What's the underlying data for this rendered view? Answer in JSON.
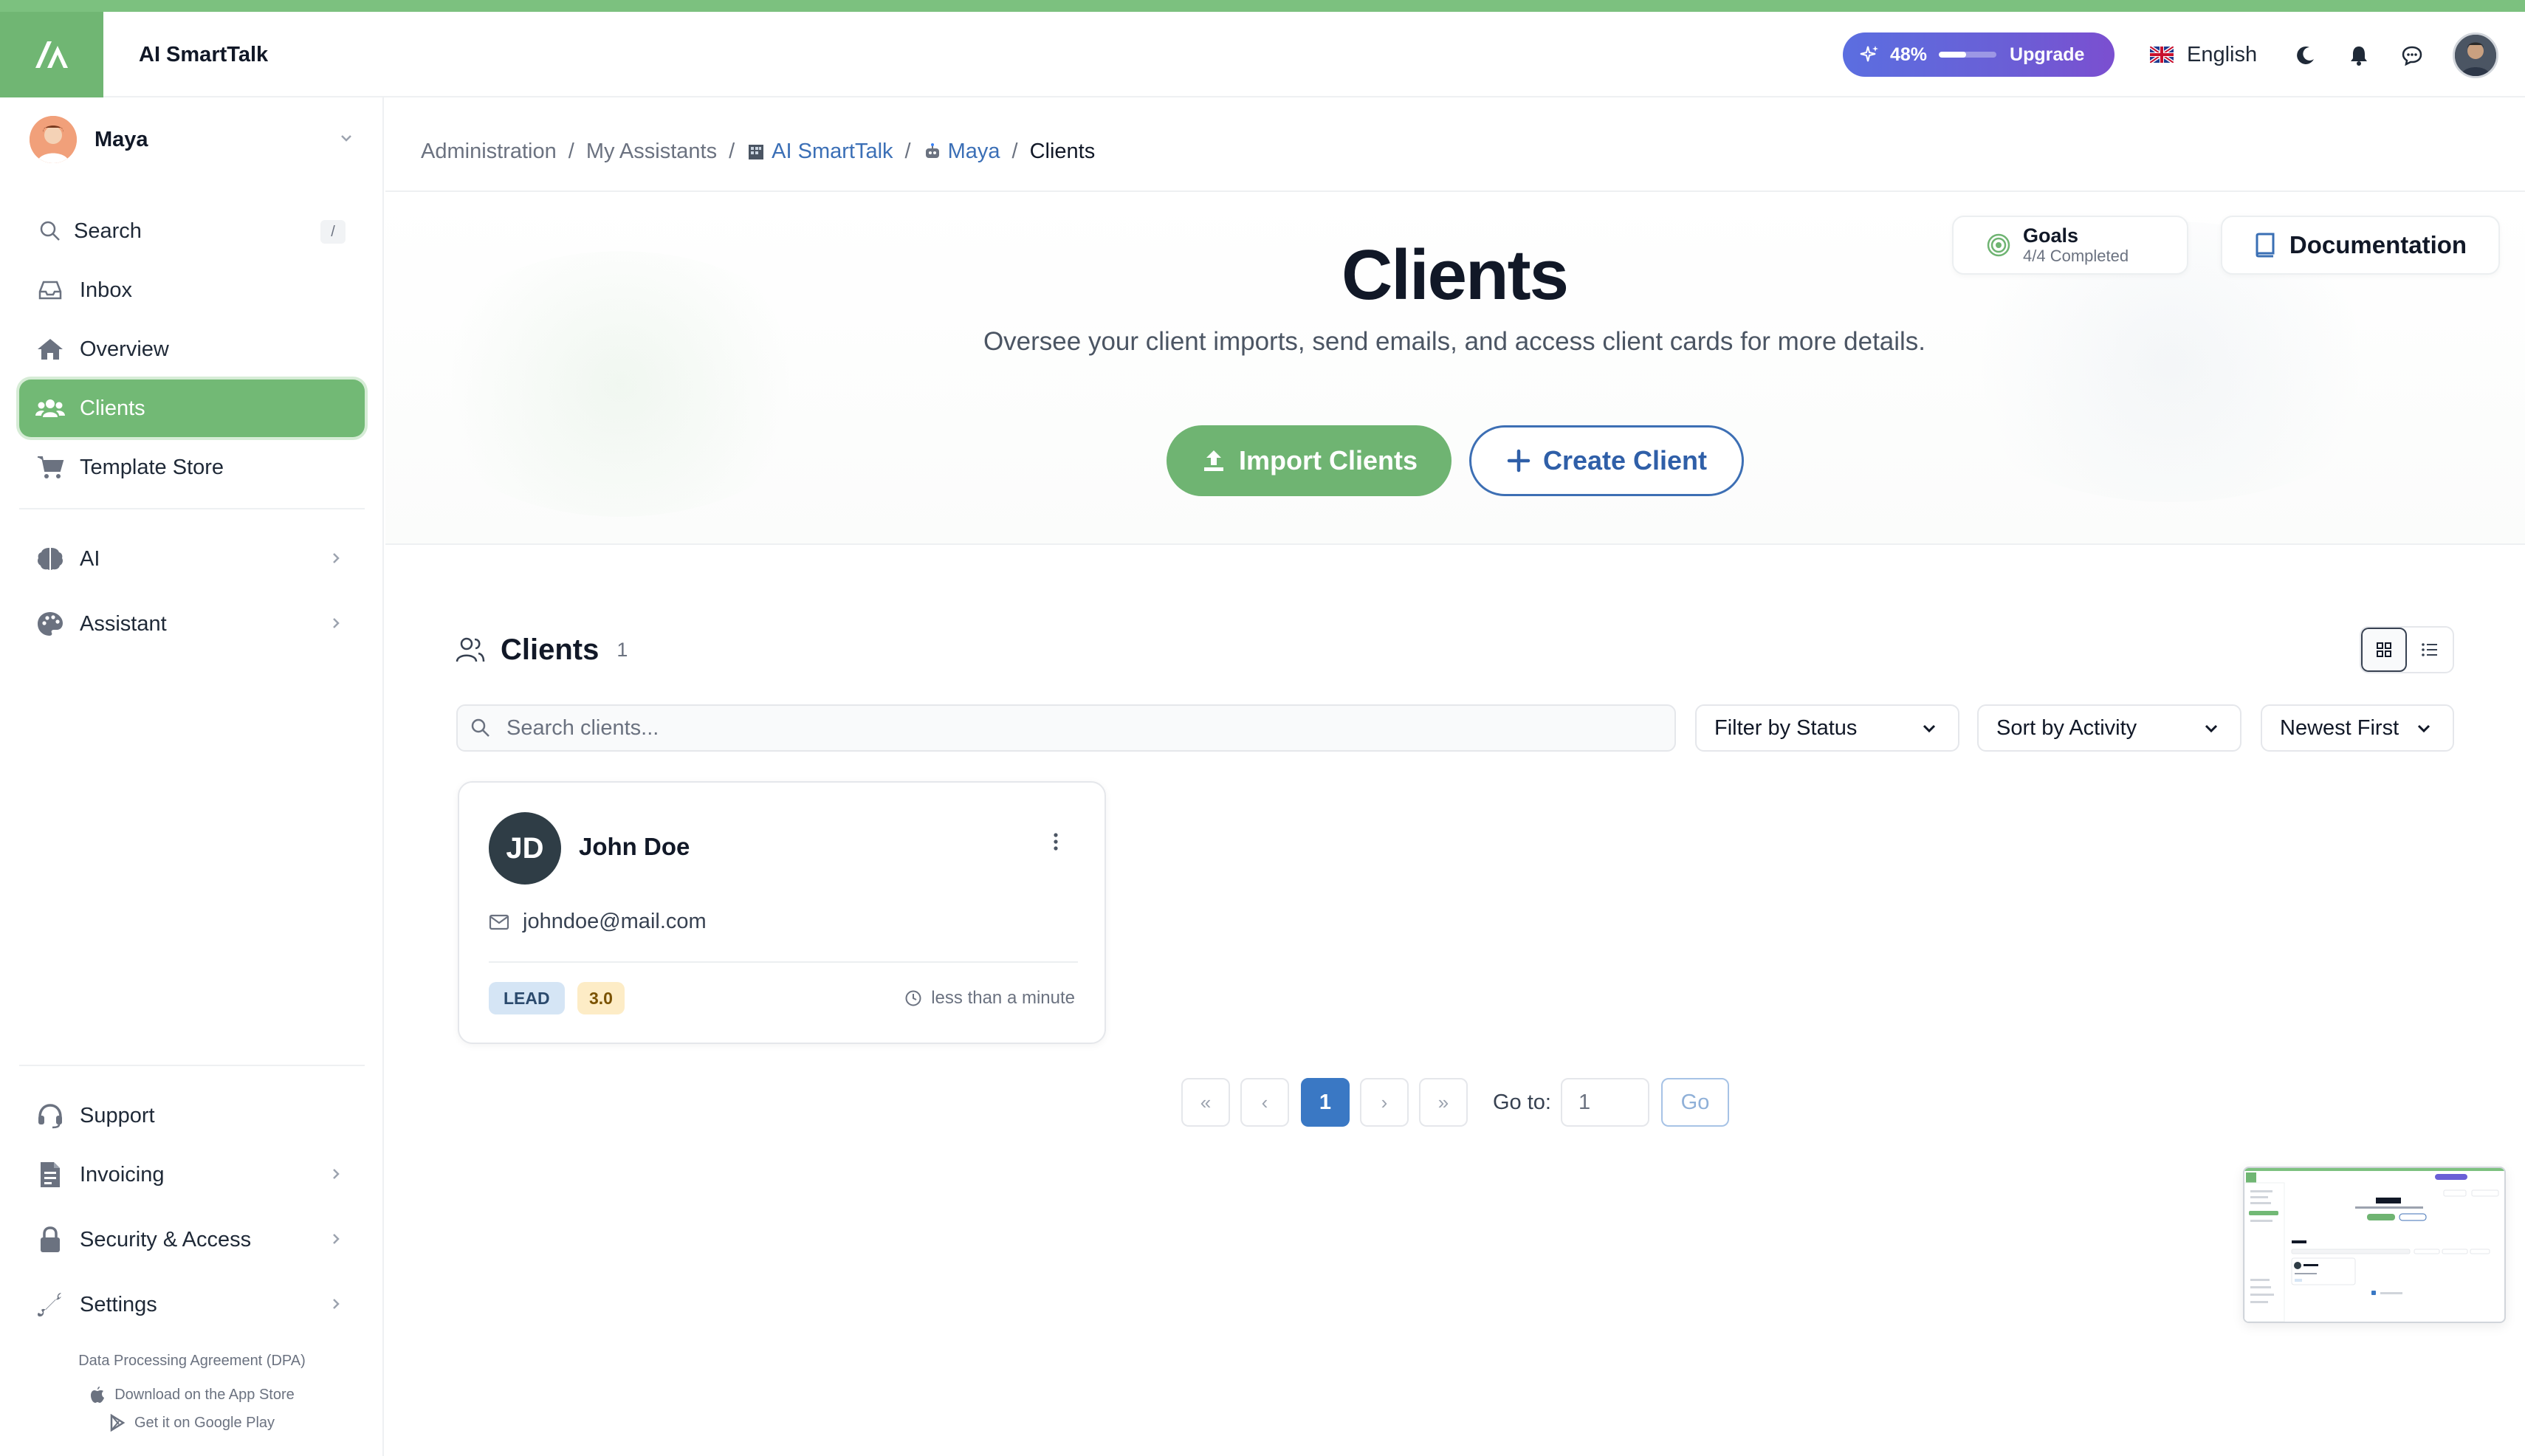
{
  "header": {
    "app_title": "AI SmartTalk",
    "usage_percent": "48%",
    "usage_fraction": 0.48,
    "upgrade_label": "Upgrade",
    "language": "English",
    "icons": [
      "logo-icon",
      "sparkle-icon",
      "uk-flag-icon",
      "moon-icon",
      "bell-icon",
      "chat-icon",
      "user-avatar"
    ]
  },
  "sidebar": {
    "user_name": "Maya",
    "items": [
      {
        "label": "Search",
        "icon": "search-icon",
        "shortcut": "/"
      },
      {
        "label": "Inbox",
        "icon": "inbox-icon"
      },
      {
        "label": "Overview",
        "icon": "home-icon"
      },
      {
        "label": "Clients",
        "icon": "users-icon",
        "active": true
      },
      {
        "label": "Template Store",
        "icon": "cart-icon"
      },
      {
        "label": "AI",
        "icon": "brain-icon"
      },
      {
        "label": "Assistant",
        "icon": "palette-icon"
      },
      {
        "label": "Support",
        "icon": "headset-icon"
      },
      {
        "label": "Invoicing",
        "icon": "invoice-icon"
      },
      {
        "label": "Security & Access",
        "icon": "lock-icon"
      },
      {
        "label": "Settings",
        "icon": "wrench-icon"
      }
    ],
    "footer": {
      "dpa": "Data Processing Agreement (DPA)",
      "app_store": "Download on the App Store",
      "google_play": "Get it on Google Play"
    }
  },
  "breadcrumb": {
    "items": [
      "Administration",
      "My Assistants",
      "AI SmartTalk",
      "Maya",
      "Clients"
    ],
    "separator": "/"
  },
  "hero": {
    "title": "Clients",
    "subtitle": "Oversee your client imports, send emails, and access client cards for more details.",
    "import_label": "Import Clients",
    "create_label": "Create Client",
    "goals_title": "Goals",
    "goals_sub": "4/4 Completed",
    "documentation_label": "Documentation"
  },
  "clients_section": {
    "title": "Clients",
    "count": "1",
    "search_placeholder": "Search clients...",
    "filter_status": "Filter by Status",
    "sort_by": "Sort by Activity",
    "order": "Newest First"
  },
  "client_card": {
    "initials": "JD",
    "name": "John Doe",
    "email": "johndoe@mail.com",
    "status": "LEAD",
    "score": "3.0",
    "last_activity": "less than a minute"
  },
  "pagination": {
    "first": "«",
    "prev": "‹",
    "current_page": "1",
    "next": "›",
    "last": "»",
    "goto_label": "Go to:",
    "goto_placeholder": "1",
    "go_label": "Go"
  },
  "colors": {
    "accent_green": "#70b673",
    "brand_blue": "#3a78c4",
    "upgrade_purple": "#6a5fd6"
  }
}
